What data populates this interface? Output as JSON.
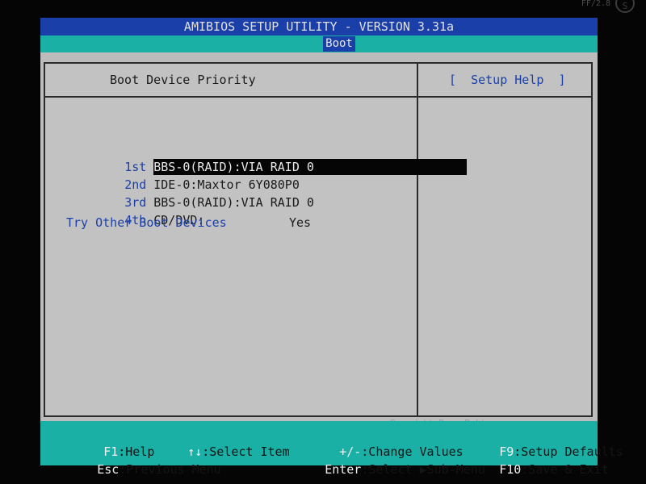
{
  "frame": {
    "top_left_text": "",
    "top_right_text": "FF/2.8",
    "circle_glyph": "S"
  },
  "header": {
    "title": "AMIBIOS SETUP UTILITY - VERSION 3.31a",
    "active_tab": "Boot"
  },
  "left_panel": {
    "title": "Boot Device Priority",
    "boot_devices": [
      {
        "label": "1st",
        "value": "BBS-0(RAID):VIA RAID 0",
        "selected": true
      },
      {
        "label": "2nd",
        "value": "IDE-0:Maxtor 6Y080P0",
        "selected": false
      },
      {
        "label": "3rd",
        "value": "BBS-0(RAID):VIA RAID 0",
        "selected": false
      },
      {
        "label": "4th",
        "value": "CD/DVD:",
        "selected": false
      }
    ],
    "try_other": {
      "label": "Try Other Boot Devices",
      "value": "Yes"
    }
  },
  "right_panel": {
    "title": "[  Setup Help  ]"
  },
  "footer": {
    "keys": [
      {
        "key": "F1",
        "desc": ":Help"
      },
      {
        "key": "↑↓",
        "desc": ":Select Item"
      },
      {
        "key": "+/-",
        "desc": ":Change Values"
      },
      {
        "key": "F9",
        "desc": ":Setup Defaults"
      },
      {
        "key": "Esc",
        "desc": ":Previous Menu"
      },
      {
        "key": "Enter",
        "desc": ":Select ▶Sub-Menu"
      },
      {
        "key": "F10",
        "desc": ":Save & Exit"
      }
    ],
    "copyright": "Copyright: Perry Babin"
  },
  "colors": {
    "title_bar": "#1a3fa8",
    "tab_bar": "#1ab0a6",
    "panel_bg": "#c2c2c2",
    "label_blue": "#1a3fa8",
    "selection_bg": "#050505"
  }
}
